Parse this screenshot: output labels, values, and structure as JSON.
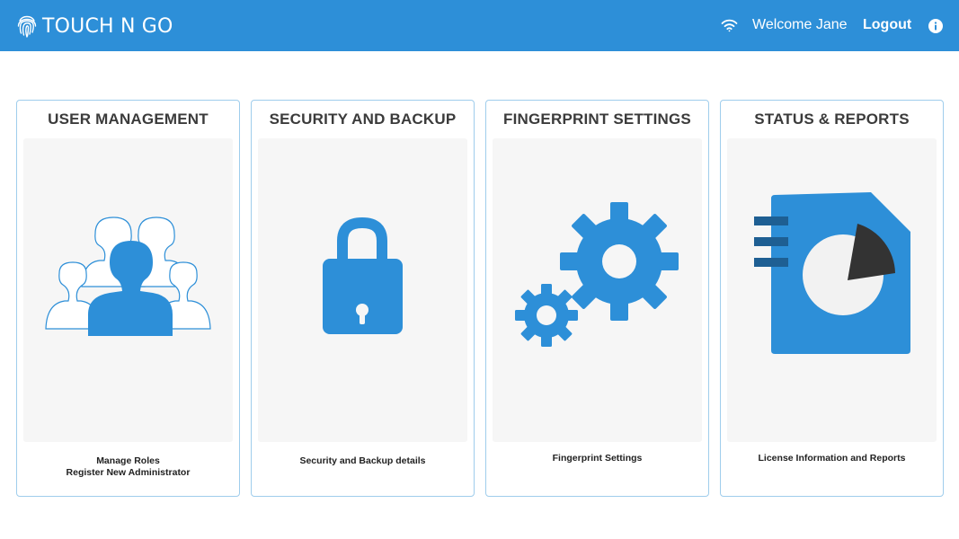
{
  "header": {
    "brand": "TOUCH N GO",
    "welcome": "Welcome Jane",
    "logout": "Logout",
    "icons": {
      "brand": "fingerprint-icon",
      "status": "wifi-icon",
      "help": "info-icon"
    }
  },
  "cards": [
    {
      "title": "USER MANAGEMENT",
      "icon": "users-icon",
      "lines": [
        "Manage Roles",
        "Register New Administrator"
      ]
    },
    {
      "title": "SECURITY AND BACKUP",
      "icon": "lock-icon",
      "lines": [
        "Security and Backup details"
      ]
    },
    {
      "title": "FINGERPRINT SETTINGS",
      "icon": "gears-icon",
      "lines": [
        "Fingerprint Settings"
      ]
    },
    {
      "title": "STATUS & REPORTS",
      "icon": "report-icon",
      "lines": [
        "License Information and Reports"
      ]
    }
  ],
  "colors": {
    "header": "#2d8fd8",
    "accent": "#2d8fd8",
    "card_border": "#9fcdec",
    "panel": "#f6f6f6",
    "text": "#3b3b3b"
  }
}
